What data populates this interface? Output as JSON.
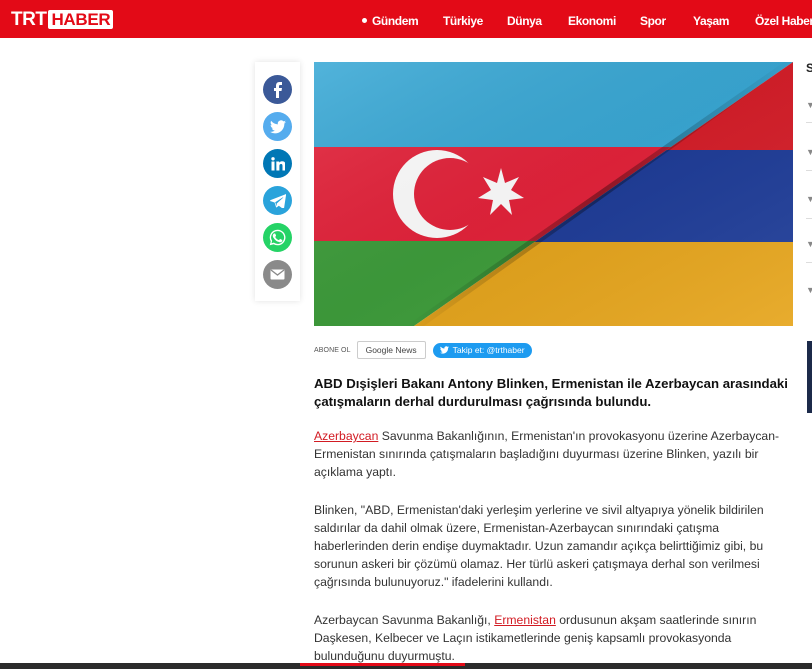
{
  "brand": {
    "logo_trt": "TRT",
    "logo_haber": "HABER",
    "primary_color": "#e30a17"
  },
  "nav": {
    "items": [
      {
        "label": "Gündem",
        "active": true
      },
      {
        "label": "Türkiye"
      },
      {
        "label": "Dünya"
      },
      {
        "label": "Ekonomi"
      },
      {
        "label": "Spor"
      },
      {
        "label": "Yaşam"
      },
      {
        "label": "Özel Haber"
      }
    ]
  },
  "share": {
    "icons": [
      "facebook-icon",
      "twitter-icon",
      "linkedin-icon",
      "telegram-icon",
      "whatsapp-icon",
      "email-icon"
    ],
    "colors": {
      "facebook": "#3b5998",
      "twitter": "#55acee",
      "linkedin": "#0077b5",
      "telegram": "#2aa3db",
      "whatsapp": "#25d366",
      "email": "#8a8a8a"
    }
  },
  "hero": {
    "flags": [
      "Azerbaijan",
      "Armenia"
    ]
  },
  "follow": {
    "abone_label": "ABONE OL",
    "google_news_label": "Google News",
    "twitter_label": "Takip et: @trthaber"
  },
  "article": {
    "lead": "ABD Dışişleri Bakanı Antony Blinken, Ermenistan ile Azerbaycan arasındaki çatışmaların derhal durdurulması çağrısında bulundu.",
    "p1_link": "Azerbaycan",
    "p1_rest": " Savunma Bakanlığının, Ermenistan'ın provokasyonu üzerine Azerbaycan-Ermenistan sınırında çatışmaların başladığını duyurması üzerine Blinken, yazılı bir açıklama yaptı.",
    "p2": "Blinken, \"ABD, Ermenistan'daki yerleşim yerlerine ve sivil altyapıya yönelik bildirilen saldırılar da dahil olmak üzere, Ermenistan-Azerbaycan sınırındaki çatışma haberlerinden derin endişe duymaktadır. Uzun zamandır açıkça belirttiğimiz gibi, bu sorunun askeri bir çözümü olamaz. Her türlü askeri çatışmaya derhal son verilmesi çağrısında bulunuyoruz.\" ifadelerini kullandı.",
    "p3_start": "Azerbaycan Savunma Bakanlığı, ",
    "p3_link": "Ermenistan",
    "p3_rest": " ordusunun akşam saatlerinde sınırın Daşkesen, Kelbecer ve Laçın istikametlerinde geniş kapsamlı provokasyonda bulunduğunu duyurmuştu."
  },
  "rail": {
    "heading_letter": "S"
  }
}
